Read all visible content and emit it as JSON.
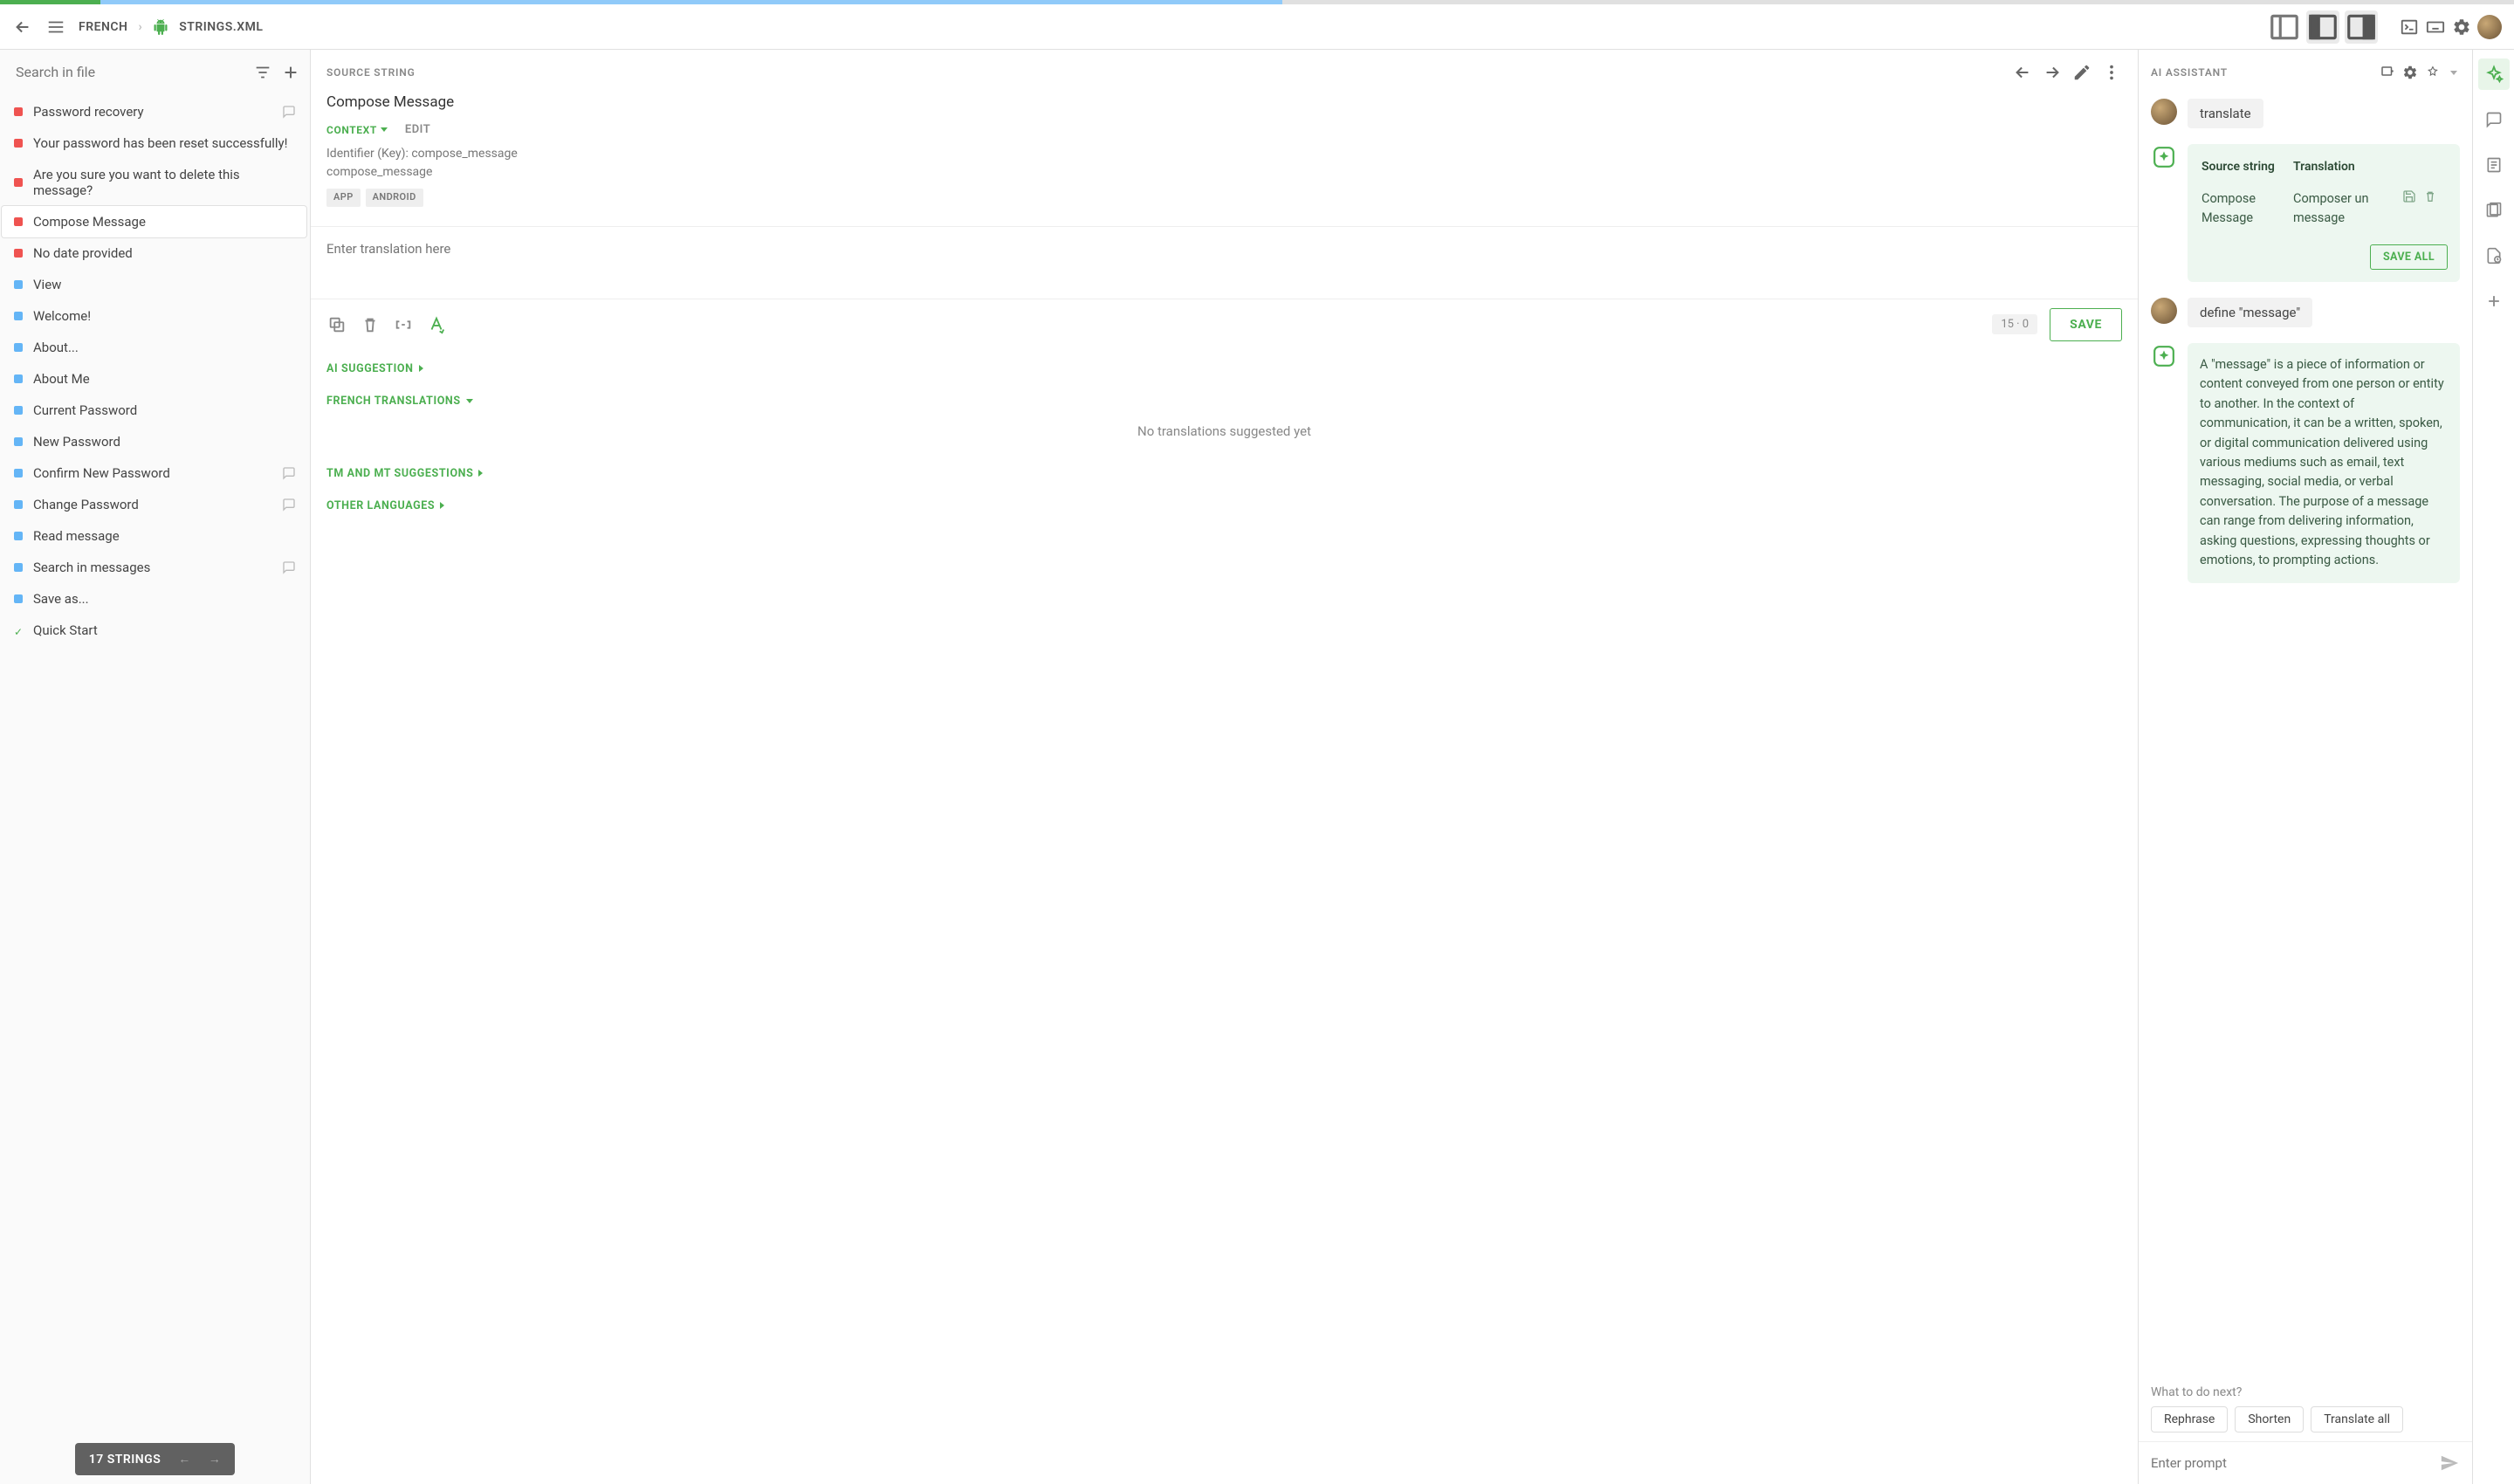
{
  "progress": {
    "green_pct": 4,
    "blue_pct": 47
  },
  "breadcrumb": {
    "language": "FRENCH",
    "file": "STRINGS.XML"
  },
  "left": {
    "search_placeholder": "Search in file",
    "strings": [
      {
        "status": "red",
        "label": "Password recovery",
        "comment": true
      },
      {
        "status": "red",
        "label": "Your password has been reset successfully!",
        "comment": false
      },
      {
        "status": "red",
        "label": "Are you sure you want to delete this message?",
        "comment": false
      },
      {
        "status": "red",
        "label": "Compose Message",
        "comment": false,
        "selected": true
      },
      {
        "status": "red",
        "label": "No date provided",
        "comment": false
      },
      {
        "status": "blue",
        "label": "View",
        "comment": false
      },
      {
        "status": "blue",
        "label": "Welcome!",
        "comment": false
      },
      {
        "status": "blue",
        "label": "About...",
        "comment": false
      },
      {
        "status": "blue",
        "label": "About Me",
        "comment": false
      },
      {
        "status": "blue",
        "label": "Current Password",
        "comment": false
      },
      {
        "status": "blue",
        "label": "New Password",
        "comment": false
      },
      {
        "status": "blue",
        "label": "Confirm New Password",
        "comment": true
      },
      {
        "status": "blue",
        "label": "Change Password",
        "comment": true
      },
      {
        "status": "blue",
        "label": "Read message",
        "comment": false
      },
      {
        "status": "blue",
        "label": "Search in messages",
        "comment": true
      },
      {
        "status": "blue",
        "label": "Save as...",
        "comment": false
      },
      {
        "status": "check",
        "label": "Quick Start",
        "comment": false
      }
    ],
    "footer": "17 STRINGS"
  },
  "center": {
    "header": "SOURCE STRING",
    "title": "Compose Message",
    "context_label": "CONTEXT",
    "edit_label": "EDIT",
    "identifier_label": "Identifier (Key): compose_message",
    "identifier_value": "compose_message",
    "tags": [
      "APP",
      "ANDROID"
    ],
    "translation_placeholder": "Enter translation here",
    "counter": "15 · 0",
    "save": "SAVE",
    "sections": {
      "ai": "AI SUGGESTION",
      "french": "FRENCH TRANSLATIONS",
      "no_translations": "No translations suggested yet",
      "tm": "TM AND MT SUGGESTIONS",
      "other": "OTHER LANGUAGES"
    }
  },
  "right": {
    "header": "AI ASSISTANT",
    "messages": [
      {
        "role": "user",
        "text": "translate"
      },
      {
        "role": "ai_table",
        "col1": "Source string",
        "col2": "Translation",
        "src": "Compose Message",
        "trg": "Composer un message",
        "save_all": "SAVE ALL"
      },
      {
        "role": "user",
        "text": "define \"message\""
      },
      {
        "role": "ai_text",
        "text": "A \"message\" is a piece of information or content conveyed from one person or entity to another. In the context of communication, it can be a written, spoken, or digital communication delivered using various mediums such as email, text messaging, social media, or verbal conversation. The purpose of a message can range from delivering information, asking questions, expressing thoughts or emotions, to prompting actions."
      }
    ],
    "suggest_label": "What to do next?",
    "chips": [
      "Rephrase",
      "Shorten",
      "Translate all"
    ],
    "prompt_placeholder": "Enter prompt"
  }
}
